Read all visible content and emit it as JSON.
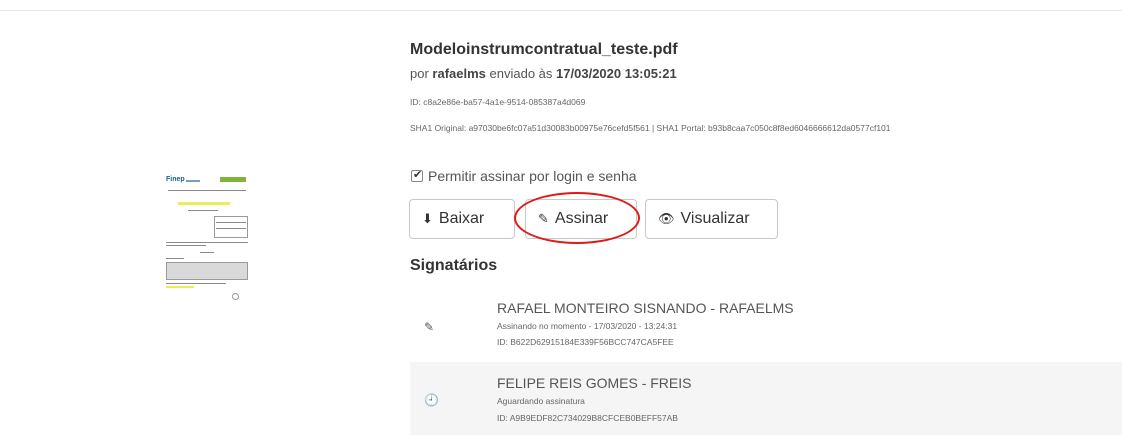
{
  "document": {
    "filename": "Modeloinstrumcontratual_teste.pdf",
    "by_prefix": "por",
    "uploader": "rafaelms",
    "sent_prefix": "enviado às",
    "sent_datetime": "17/03/2020 13:05:21",
    "id_line": "ID: c8a2e86e-ba57-4a1e-9514-085387a4d069",
    "sha_line": "SHA1 Original: a97030be6fc07a51d30083b00975e76cefd5f561 | SHA1 Portal: b93b8caa7c050c8f8ed6046666612da0577cf101"
  },
  "options": {
    "allow_login_label": "Permitir assinar por login e senha",
    "allow_login_checked": true
  },
  "actions": {
    "download_label": "Baixar",
    "sign_label": "Assinar",
    "view_label": "Visualizar",
    "download_icon": "download-icon",
    "sign_icon": "pencil-icon",
    "view_icon": "eye-icon"
  },
  "signers_title": "Signatários",
  "signers": [
    {
      "name": "RAFAEL MONTEIRO SISNANDO - RAFAELMS",
      "status": "Assinando no momento - 17/03/2020 - 13:24:31",
      "id": "ID: B622D62915184E339F56BCC747CA5FEE",
      "icon": "pencil-icon"
    },
    {
      "name": "FELIPE REIS GOMES - FREIS",
      "status": "Aguardando assinatura",
      "id": "ID: A9B9EDF82C734029B8CFCEB0BEFF57AB",
      "icon": "clock-icon"
    }
  ],
  "colors": {
    "highlight_ellipse": "#e01a1a",
    "row_alt_background": "#f5f5f5"
  }
}
